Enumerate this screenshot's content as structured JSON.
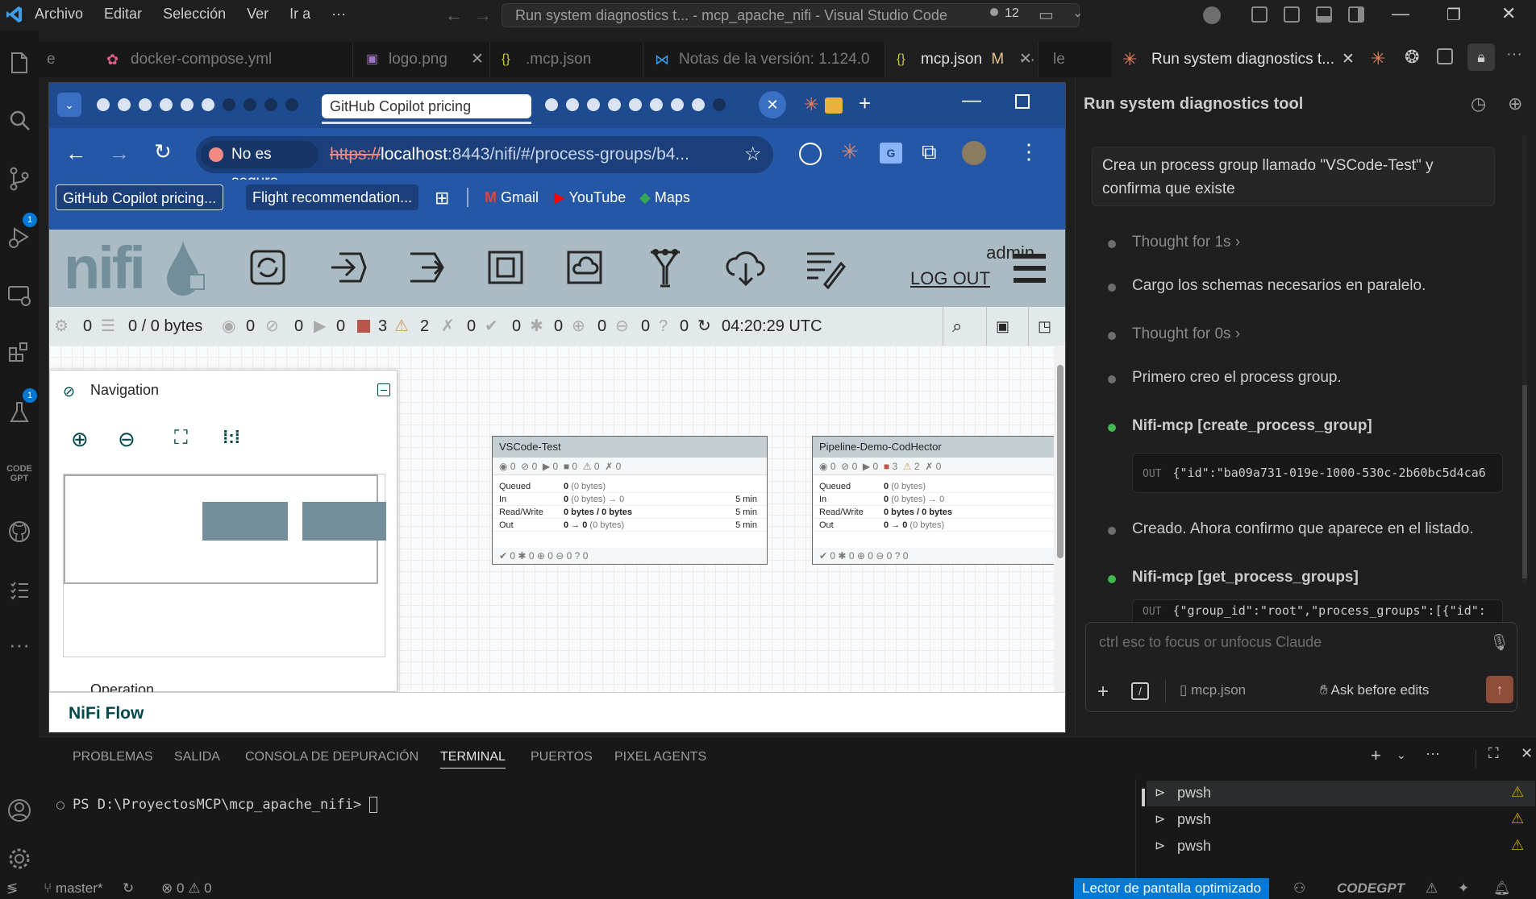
{
  "menu": [
    "Archivo",
    "Editar",
    "Selección",
    "Ver",
    "Ir a",
    "···"
  ],
  "command_center": "Run system diagnostics t... - mcp_apache_nifi - Visual Studio Code",
  "copilot_count": "12",
  "activity": {
    "scm_badge": "1",
    "ext_badge": "1",
    "codegpt_label": "CODE GPT"
  },
  "editor_tabs": [
    {
      "label": "docker-compose.yml",
      "state": "inactive"
    },
    {
      "label": "logo.png",
      "state": "inactive"
    },
    {
      "label": ".mcp.json",
      "state": "inactive"
    },
    {
      "label": "Notas de la versión: 1.124.0",
      "state": "inactive"
    },
    {
      "label": "mcp.json",
      "modified": "M",
      "state": "active"
    },
    {
      "label": "le",
      "state": "inactive"
    }
  ],
  "chat_tab_title": "Run system diagnostics t...",
  "chrome": {
    "active_tab": "GitHub Copilot pricing",
    "security_label": "No es seguro",
    "url_scheme": "https://",
    "url_host": "localhost",
    "url_rest": ":8443/nifi/#/process-groups/b4...",
    "bookmarks": [
      "GitHub Copilot pricing...",
      "Flight recommendation...",
      "Gmail",
      "YouTube",
      "Maps"
    ]
  },
  "nifi": {
    "logo": "nifi",
    "user": "admin",
    "logout": "LOG OUT",
    "status": {
      "active_threads": "0",
      "queued": "0 / 0 bytes",
      "transmitting": "0",
      "not_transmitting": "0",
      "running": "0",
      "stopped": "3",
      "invalid": "2",
      "disabled": "0",
      "up_to_date": "0",
      "locally_modified": "0",
      "stale": "0",
      "locally_modified_stale": "0",
      "sync_failure": "0",
      "refresh_time": "04:20:29 UTC"
    },
    "navigation_title": "Navigation",
    "operation_title": "Operation",
    "breadcrumb": "NiFi Flow",
    "process_groups": [
      {
        "name": "VSCode-Test",
        "counts": [
          "0",
          "0",
          "0",
          "0",
          "0",
          "0"
        ],
        "rows": [
          {
            "label": "Queued",
            "value": "0",
            "detail": "(0 bytes)",
            "time": ""
          },
          {
            "label": "In",
            "value": "0",
            "detail": "(0 bytes) → 0",
            "time": "5 min"
          },
          {
            "label": "Read/Write",
            "value": "0 bytes / 0 bytes",
            "detail": "",
            "time": "5 min"
          },
          {
            "label": "Out",
            "value": "0 → 0",
            "detail": "(0 bytes)",
            "time": "5 min"
          }
        ],
        "footer": [
          "0",
          "0",
          "0",
          "0",
          "0"
        ]
      },
      {
        "name": "Pipeline-Demo-CodHector",
        "counts": [
          "0",
          "0",
          "0",
          "3",
          "2",
          "0"
        ],
        "rows": [
          {
            "label": "Queued",
            "value": "0",
            "detail": "(0 bytes)",
            "time": ""
          },
          {
            "label": "In",
            "value": "0",
            "detail": "(0 bytes) → 0",
            "time": ""
          },
          {
            "label": "Read/Write",
            "value": "0 bytes / 0 bytes",
            "detail": "",
            "time": ""
          },
          {
            "label": "Out",
            "value": "0 → 0",
            "detail": "(0 bytes)",
            "time": ""
          }
        ],
        "footer": [
          "0",
          "0",
          "0",
          "0",
          "0"
        ]
      }
    ]
  },
  "chat": {
    "header": "Run system diagnostics tool",
    "user_message": "Crea un process group llamado \"VSCode-Test\" y confirma que existe",
    "steps": [
      {
        "type": "thought",
        "text": "Thought for 1s"
      },
      {
        "type": "text",
        "text": "Cargo los schemas necesarios en paralelo."
      },
      {
        "type": "thought",
        "text": "Thought for 0s"
      },
      {
        "type": "text",
        "text": "Primero creo el process group."
      },
      {
        "type": "tool",
        "text": "Nifi-mcp [create_process_group]",
        "out_label": "OUT",
        "out": "{\"id\":\"ba09a731-019e-1000-530c-2b60bc5d4ca6"
      },
      {
        "type": "text",
        "text": "Creado. Ahora confirmo que aparece en el listado."
      },
      {
        "type": "tool",
        "text": "Nifi-mcp [get_process_groups]",
        "out_label": "OUT",
        "out": "{\"group_id\":\"root\",\"process_groups\":[{\"id\":"
      }
    ],
    "input_placeholder": "ctrl esc to focus or unfocus Claude",
    "file_chip": "mcp.json",
    "mode": "Ask before edits"
  },
  "panel": {
    "tabs": [
      "PROBLEMAS",
      "SALIDA",
      "CONSOLA DE DEPURACIÓN",
      "TERMINAL",
      "PUERTOS",
      "PIXEL AGENTS"
    ],
    "active_tab": "TERMINAL",
    "prompt": "PS D:\\ProyectosMCP\\mcp_apache_nifi>",
    "terminals": [
      "pwsh",
      "pwsh",
      "pwsh"
    ]
  },
  "statusbar": {
    "branch": "master*",
    "errors": "0",
    "warnings": "0",
    "screen_reader": "Lector de pantalla optimizado",
    "codegpt": "CODEGPT"
  },
  "colors": {
    "vscode_bg": "#1f1f1f",
    "chrome_blue": "#2557a7",
    "nifi_header": "#aabbc3",
    "nifi_teal": "#004849",
    "accent": "#0078d4",
    "status_green": "#3fb950"
  }
}
